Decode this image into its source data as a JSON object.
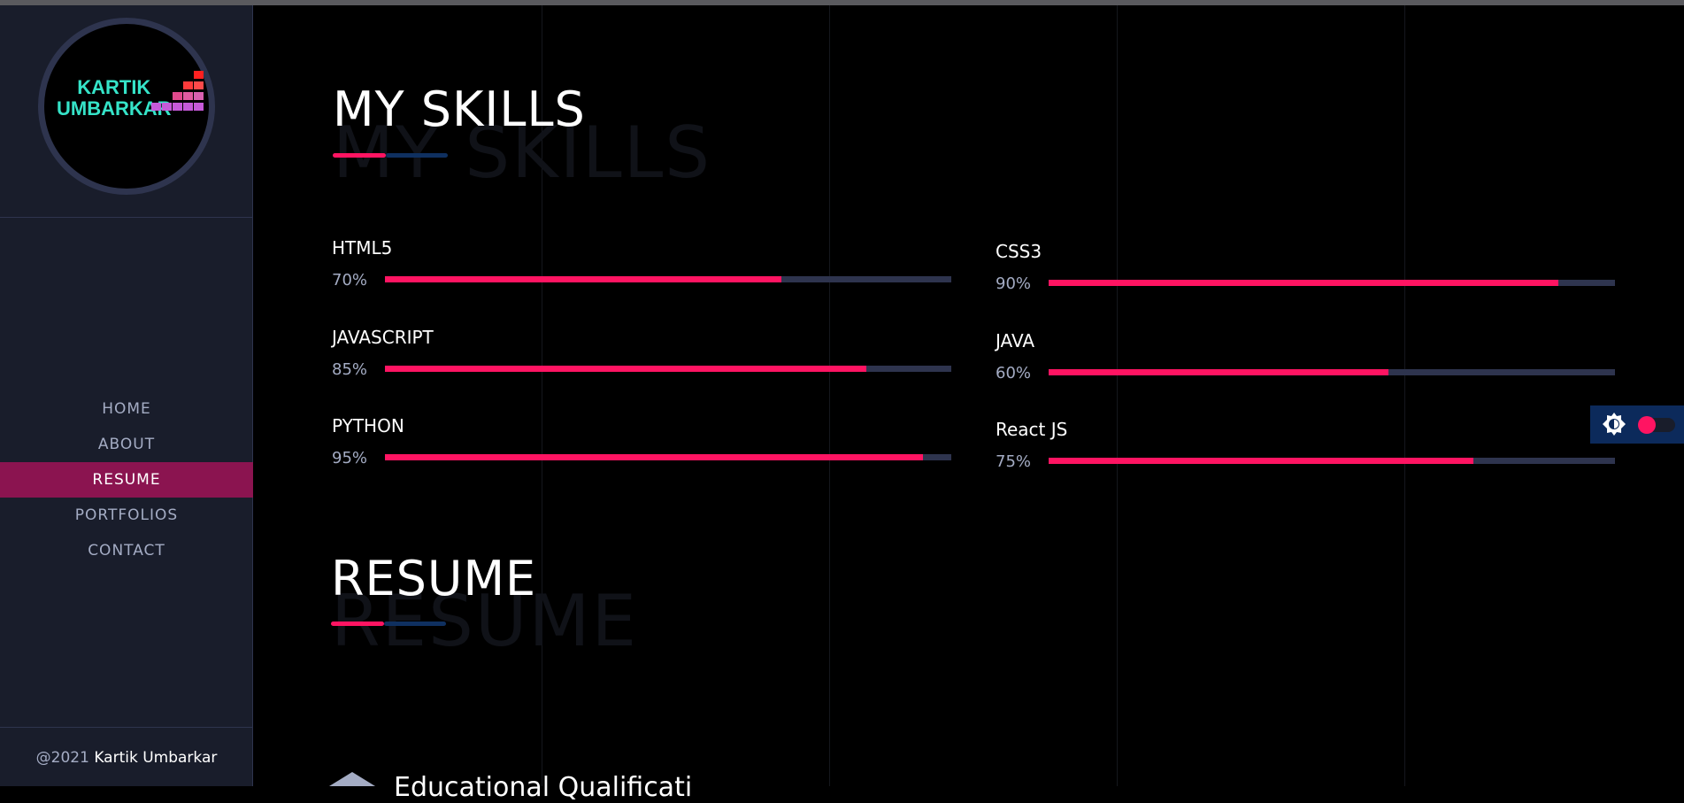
{
  "logo": {
    "line1": "KARTIK",
    "line2": "UMBARKAR"
  },
  "nav": [
    {
      "label": "HOME",
      "active": false
    },
    {
      "label": "ABOUT",
      "active": false
    },
    {
      "label": "RESUME",
      "active": true
    },
    {
      "label": "PORTFOLIOS",
      "active": false
    },
    {
      "label": "CONTACT",
      "active": false
    }
  ],
  "footer": {
    "prefix": "@2021 ",
    "name": "Kartik Umbarkar"
  },
  "skills_section": {
    "title": "MY SKILLS",
    "ghost": "MY SKILLS"
  },
  "skills": [
    {
      "name": "HTML5",
      "percent_label": "70%",
      "percent": 70
    },
    {
      "name": "CSS3",
      "percent_label": "90%",
      "percent": 90
    },
    {
      "name": "JAVASCRIPT",
      "percent_label": "85%",
      "percent": 85
    },
    {
      "name": "JAVA",
      "percent_label": "60%",
      "percent": 60
    },
    {
      "name": "PYTHON",
      "percent_label": "95%",
      "percent": 95
    },
    {
      "name": "React JS",
      "percent_label": "75%",
      "percent": 75
    }
  ],
  "resume_section": {
    "title": "RESUME",
    "ghost": "RESUME"
  },
  "education_heading": "Educational Qualificati",
  "colors": {
    "accent": "#ff1462",
    "sidebar": "#191d2b",
    "track": "#2e344e",
    "active_nav": "#8b1450"
  },
  "icons": {
    "theme_toggle": "sun-icon",
    "education": "graduation-cap-icon"
  }
}
